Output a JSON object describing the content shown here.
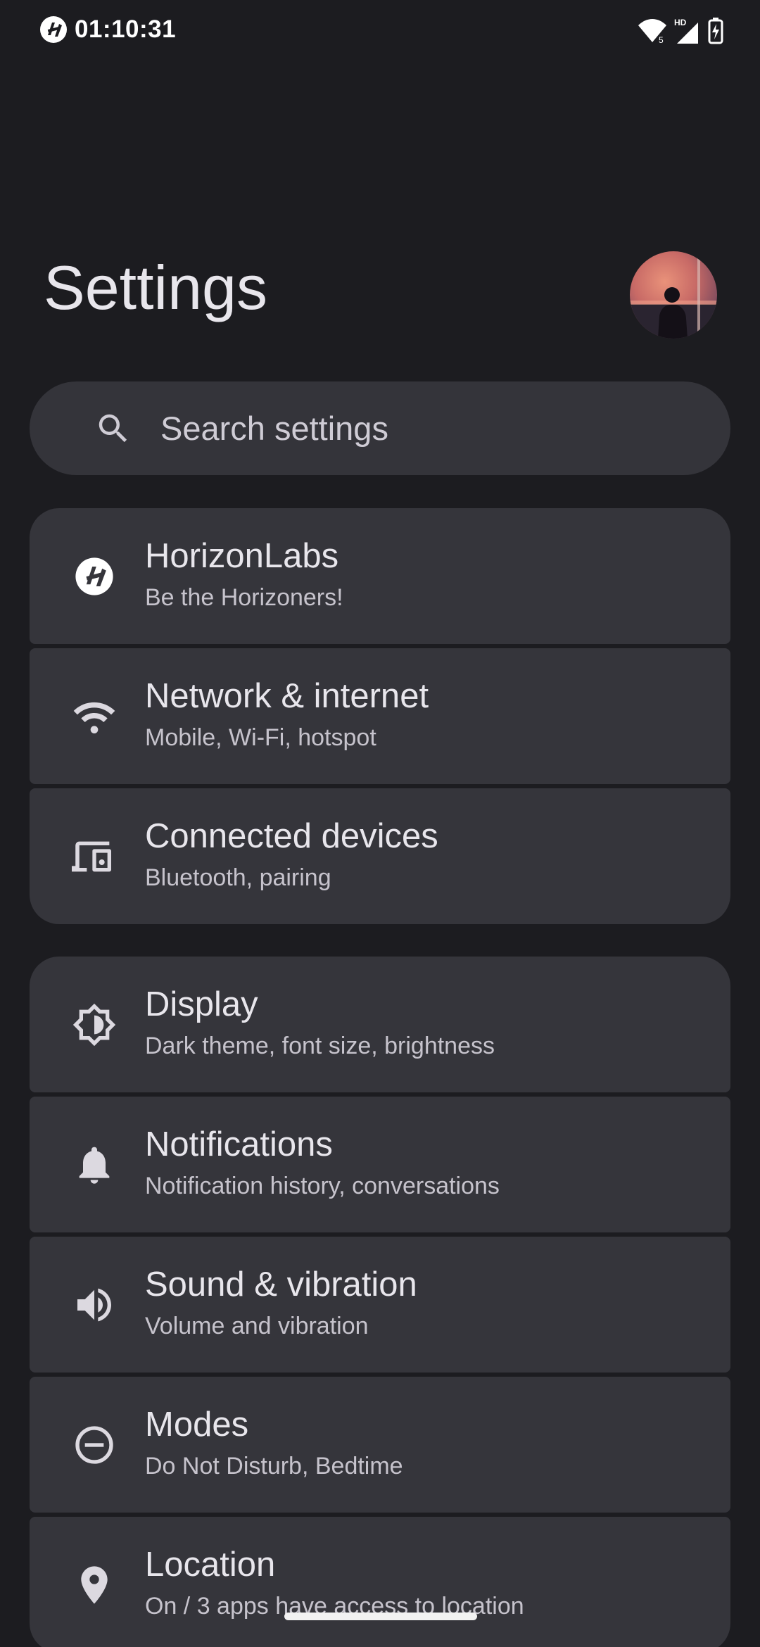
{
  "status_bar": {
    "time": "01:10:31",
    "icons": [
      "horizonlabs-logo-icon",
      "wifi-icon",
      "signal-hd-icon",
      "battery-charging-icon"
    ]
  },
  "header": {
    "title": "Settings"
  },
  "search": {
    "placeholder": "Search settings"
  },
  "groups": [
    {
      "items": [
        {
          "title": "HorizonLabs",
          "subtitle": "Be the Horizoners!",
          "icon": "horizonlabs-icon"
        },
        {
          "title": "Network & internet",
          "subtitle": "Mobile, Wi-Fi, hotspot",
          "icon": "wifi-icon"
        },
        {
          "title": "Connected devices",
          "subtitle": "Bluetooth, pairing",
          "icon": "devices-icon"
        }
      ]
    },
    {
      "items": [
        {
          "title": "Display",
          "subtitle": "Dark theme, font size, brightness",
          "icon": "brightness-icon"
        },
        {
          "title": "Notifications",
          "subtitle": "Notification history, conversations",
          "icon": "bell-icon"
        },
        {
          "title": "Sound & vibration",
          "subtitle": "Volume and vibration",
          "icon": "volume-icon"
        },
        {
          "title": "Modes",
          "subtitle": "Do Not Disturb, Bedtime",
          "icon": "minus-circle-icon"
        },
        {
          "title": "Location",
          "subtitle": "On / 3 apps have access to location",
          "icon": "location-pin-icon"
        }
      ]
    }
  ],
  "colors": {
    "background": "#1c1c20",
    "card": "#35353b",
    "search_bar": "#34343a",
    "text_primary": "#e8e6ec",
    "text_secondary": "#c6c3cc"
  }
}
